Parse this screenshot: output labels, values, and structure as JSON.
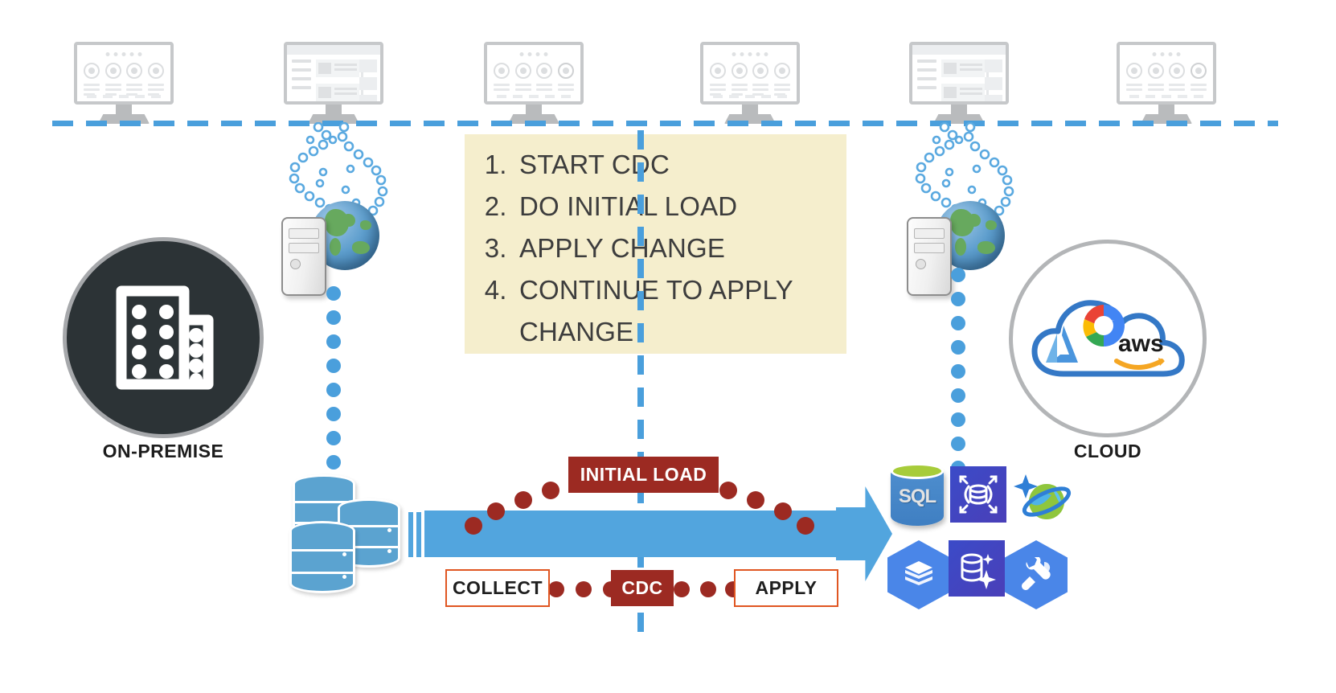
{
  "diagram": {
    "title": "CDC Data Migration From On-Premise To Cloud",
    "background": "#ffffff"
  },
  "colors": {
    "blue_accent": "#4a9fdc",
    "arrow_blue": "#52a5de",
    "dark_red": "#9c2a22",
    "orange_border": "#e05622",
    "callout_bg": "#f5eecd",
    "onprem_circle_bg": "#2c3336",
    "circle_border_gray": "#a6a8ab",
    "db_blue": "#5ba3d0",
    "monitor_gray": "#c6c8ca"
  },
  "callout": {
    "steps": [
      "START CDC",
      "DO INITIAL LOAD",
      "APPLY CHANGE",
      "CONTINUE TO APPLY CHANGE"
    ]
  },
  "zones": {
    "left": {
      "label": "ON-PREMISE",
      "icon": "office-building-icon"
    },
    "right": {
      "label": "CLOUD",
      "icon": "cloud-icon",
      "providers": [
        "azure",
        "google-cloud",
        "aws"
      ],
      "aws_wordmark": "aws"
    }
  },
  "flow_labels": {
    "initial_load": "INITIAL LOAD",
    "collect": "COLLECT",
    "cdc": "CDC",
    "apply": "APPLY"
  },
  "monitors": {
    "count": 6,
    "types": [
      "dashboard",
      "article",
      "dashboard",
      "dashboard",
      "article",
      "dashboard"
    ]
  },
  "source": {
    "server_icon": "server-globe-icon",
    "database_icon": "database-stack-icon"
  },
  "targets": [
    {
      "name": "sql-server-icon",
      "label": "SQL"
    },
    {
      "name": "azure-elastic-pool-icon",
      "label": ""
    },
    {
      "name": "azure-cosmos-db-icon",
      "label": ""
    },
    {
      "name": "gcp-bigtable-icon",
      "label": ""
    },
    {
      "name": "gcp-spanner-icon",
      "label": ""
    },
    {
      "name": "gcp-dataprep-icon",
      "label": ""
    }
  ]
}
